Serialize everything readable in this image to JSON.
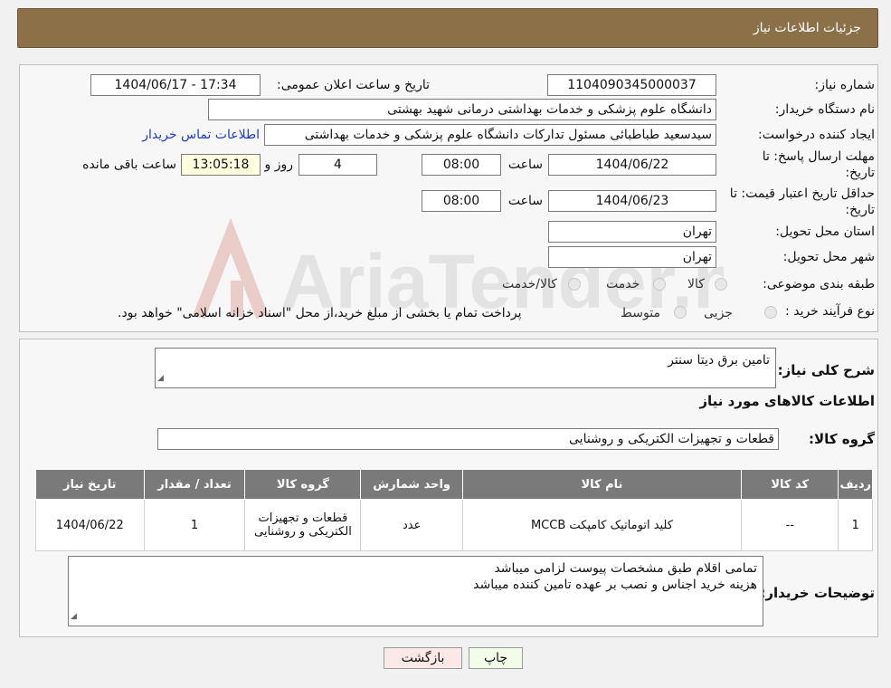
{
  "header": {
    "title": "جزئیات اطلاعات نیاز"
  },
  "fields": {
    "need_number_label": "شماره نیاز:",
    "need_number": "1104090345000037",
    "announce_label": "تاریخ و ساعت اعلان عمومی:",
    "announce_value": "1404/06/17 - 17:34",
    "buyer_org_label": "نام دستگاه خریدار:",
    "buyer_org": "دانشگاه علوم پزشکی و خدمات بهداشتی درمانی شهید بهشتی",
    "requester_label": "ایجاد کننده درخواست:",
    "requester": "سیدسعید طباطبائی مسئول تدارکات دانشگاه علوم پزشکی و خدمات بهداشتی",
    "contact_link": "اطلاعات تماس خریدار",
    "deadline_label_1": "مهلت ارسال پاسخ: تا",
    "deadline_label_2": "تاریخ:",
    "deadline_date": "1404/06/22",
    "time_label": "ساعت",
    "deadline_time": "08:00",
    "days_value": "4",
    "days_label": "روز و",
    "remaining_time": "13:05:18",
    "remaining_label": "ساعت باقی مانده",
    "validity_label_1": "حداقل تاریخ اعتبار قیمت: تا",
    "validity_label_2": "تاریخ:",
    "validity_date": "1404/06/23",
    "validity_time": "08:00",
    "province_label": "استان محل تحویل:",
    "province": "تهران",
    "city_label": "شهر محل تحویل:",
    "city": "تهران",
    "category_label": "طبقه بندی موضوعی:",
    "category_options": [
      "کالا",
      "خدمت",
      "کالا/خدمت"
    ],
    "process_label": "نوع فرآیند خرید :",
    "process_options": [
      "جزیی",
      "متوسط"
    ],
    "process_note": "پرداخت تمام یا بخشی از مبلغ خرید،از محل \"اسناد خزانه اسلامی\" خواهد بود."
  },
  "details": {
    "description_label": "شرح کلی نیاز:",
    "description": "تامین برق دیتا سنتر",
    "goods_info_title": "اطلاعات کالاهای مورد نیاز",
    "goods_group_label": "گروه کالا:",
    "goods_group": "قطعات و تجهیزات الکتریکی و روشنایی"
  },
  "table": {
    "headers": [
      "ردیف",
      "کد کالا",
      "نام کالا",
      "واحد شمارش",
      "گروه کالا",
      "تعداد / مقدار",
      "تاریخ نیاز"
    ],
    "rows": [
      [
        "1",
        "--",
        "کلید اتوماتیک کامپکت MCCB",
        "عدد",
        "قطعات و تجهیزات الکتریکی و روشنایی",
        "1",
        "1404/06/22"
      ]
    ]
  },
  "buyer_notes": {
    "label": "توضیحات خریدار:",
    "line1": "تمامی اقلام طبق مشخصات پیوست لزامی میباشد",
    "line2": "هزینه خرید اجناس و نصب بر عهده تامین کننده میباشد"
  },
  "buttons": {
    "print": "چاپ",
    "back": "بازگشت"
  },
  "watermark": {
    "text": "AriaTender.neT",
    "color": "#c0392b"
  }
}
